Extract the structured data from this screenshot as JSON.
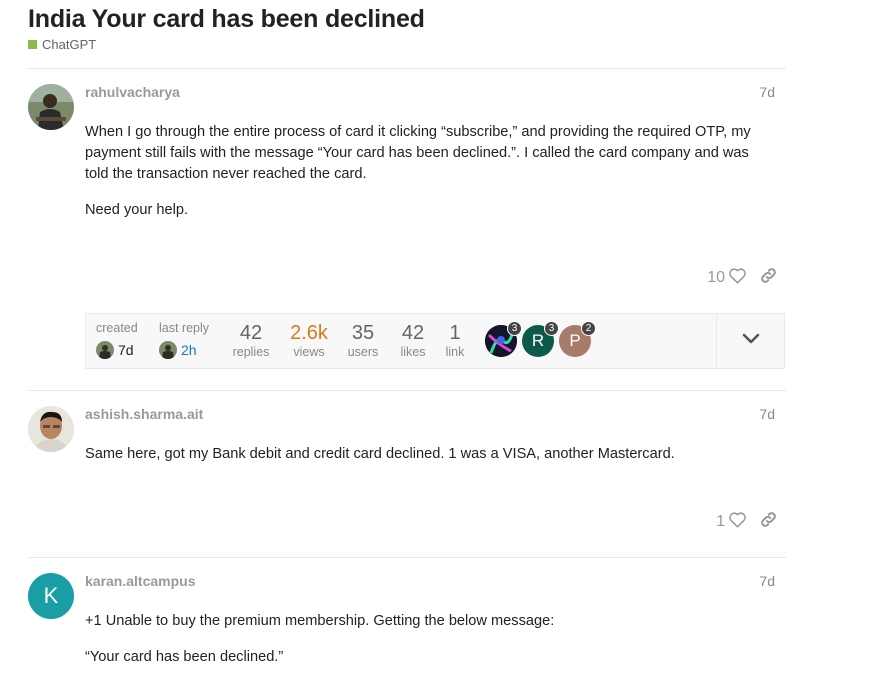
{
  "topic": {
    "title": "India Your card has been declined",
    "category": "ChatGPT",
    "category_color": "#91b84b"
  },
  "posts": [
    {
      "username": "rahulvacharya",
      "date": "7d",
      "paragraphs": [
        "When I go through the entire process of card it clicking “subscribe,” and providing the required OTP, my payment still fails with the message “Your card has been declined.”. I called the card company and was told the transaction never reached the card.",
        "Need your help."
      ],
      "likes": "10"
    },
    {
      "username": "ashish.sharma.ait",
      "date": "7d",
      "paragraphs": [
        "Same here, got my Bank debit and credit card declined. 1 was a VISA, another Mastercard."
      ],
      "likes": "1"
    },
    {
      "username": "karan.altcampus",
      "date": "7d",
      "avatar_letter": "K",
      "avatar_color": "#1a9ea5",
      "paragraphs": [
        "+1 Unable to buy the premium membership. Getting the below message:",
        "“Your card has been declined.”"
      ]
    }
  ],
  "topic_map": {
    "created_label": "created",
    "created_value": "7d",
    "last_reply_label": "last reply",
    "last_reply_value": "2h",
    "replies": "42",
    "replies_label": "replies",
    "views": "2.6k",
    "views_label": "views",
    "users": "35",
    "users_label": "users",
    "likes": "42",
    "likes_label": "likes",
    "links": "1",
    "links_label": "link",
    "participants": [
      {
        "letter": "",
        "count": "3",
        "color": "#1b1b2e"
      },
      {
        "letter": "R",
        "count": "3",
        "color": "#0e5a4a"
      },
      {
        "letter": "P",
        "count": "2",
        "color": "#a87a6a"
      }
    ]
  }
}
